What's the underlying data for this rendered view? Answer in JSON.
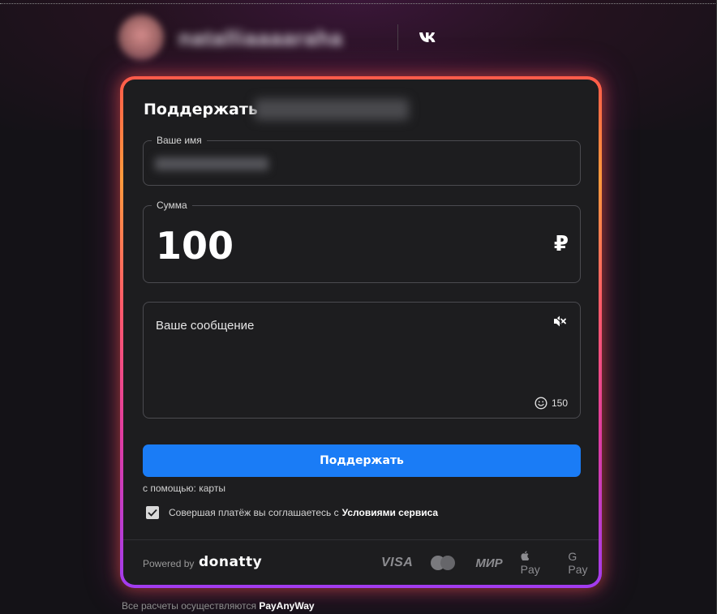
{
  "header": {
    "username": "natalliaaaaraha",
    "vk_icon": "vk-icon"
  },
  "form": {
    "title": "Поддержать",
    "title_name": "Natalia Fedorova",
    "name_field": {
      "label": "Ваше имя",
      "value": "Natalia Fedorova"
    },
    "amount_field": {
      "label": "Сумма",
      "value": "100",
      "currency": "₽"
    },
    "message_field": {
      "placeholder": "Ваше сообщение",
      "char_count": "150"
    },
    "submit_label": "Поддержать",
    "method_text": "с помощью: карты",
    "agree_text": "Совершая платёж вы соглашаетесь с",
    "agree_link": "Условиями сервиса",
    "agree_checked": true,
    "powered_by": "Powered by",
    "brand": "donatty",
    "payment_logos": [
      "VISA",
      "mastercard",
      "МИР",
      "Pay",
      "G Pay"
    ]
  },
  "footer": {
    "text": "Все расчеты осуществляются",
    "provider": "PayAnyWay"
  },
  "colors": {
    "accent": "#1a7cf6",
    "card_bg": "#1d1d1f",
    "page_bg": "#141217"
  }
}
